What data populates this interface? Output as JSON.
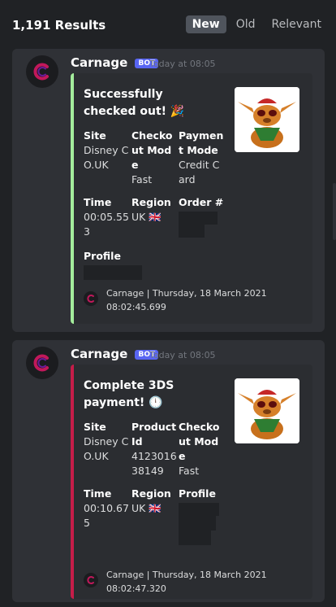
{
  "header": {
    "results": "1,191 Results",
    "tabs": [
      "New",
      "Old",
      "Relevant"
    ],
    "active_tab": "New"
  },
  "messages": [
    {
      "author": "Carnage",
      "badge": "BOT",
      "timestamp": "Today at 08:05",
      "accent": "#a4ec9c",
      "title": "Successfully checked out! 🎉",
      "thumbnail_icon": "stitch-plush-image",
      "fields": [
        {
          "name": "Site",
          "value": "Disney CO.UK"
        },
        {
          "name": "Checkout Mode",
          "value": "Fast"
        },
        {
          "name": "Payment Mode",
          "value": "Credit Card"
        },
        {
          "name": "Time",
          "value": "00:05.553"
        },
        {
          "name": "Region",
          "value": "UK 🇬🇧"
        },
        {
          "name": "Order #",
          "value": ""
        },
        {
          "name": "Profile",
          "value": ""
        }
      ],
      "footer": "Carnage | Thursday, 18 March 2021 08:02:45.699"
    },
    {
      "author": "Carnage",
      "badge": "BOT",
      "timestamp": "Today at 08:05",
      "accent": "#c51d49",
      "title": "Complete 3DS payment! 🕛",
      "thumbnail_icon": "stitch-plush-image",
      "fields": [
        {
          "name": "Site",
          "value": "Disney CO.UK"
        },
        {
          "name": "Product Id",
          "value": "412301638149"
        },
        {
          "name": "Checkout Mode",
          "value": "Fast"
        },
        {
          "name": "Time",
          "value": "00:10.675"
        },
        {
          "name": "Region",
          "value": "UK 🇬🇧"
        },
        {
          "name": "Profile",
          "value": ""
        }
      ],
      "footer": "Carnage | Thursday, 18 March 2021 08:02:47.320"
    }
  ]
}
